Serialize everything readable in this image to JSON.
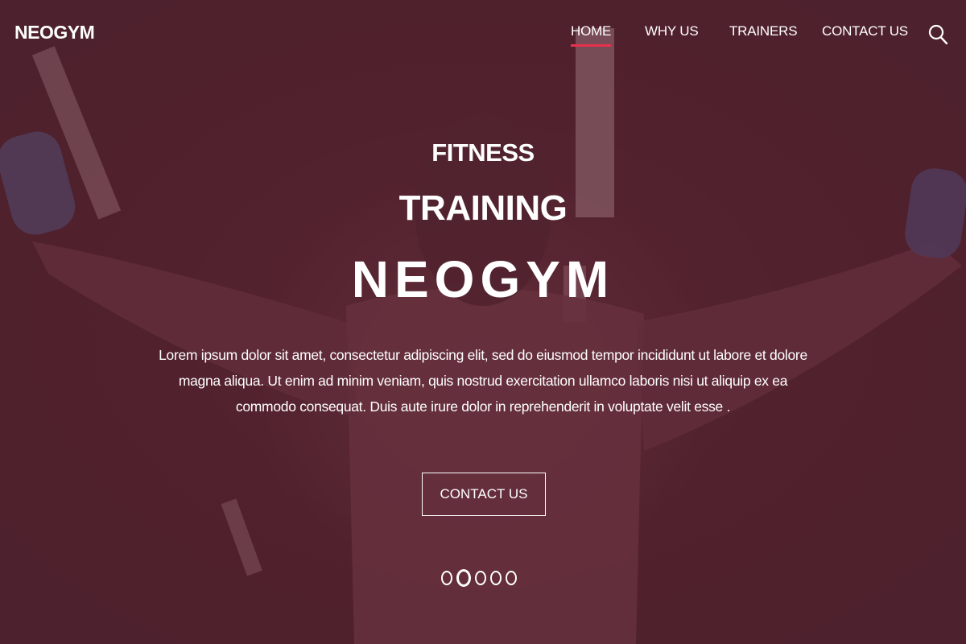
{
  "brand": {
    "logo_text": "NEOGYM"
  },
  "nav": {
    "items": [
      {
        "label": "HOME",
        "active": true
      },
      {
        "label": "WHY US",
        "active": false
      },
      {
        "label": "TRAINERS",
        "active": false
      },
      {
        "label": "CONTACT US",
        "active": false
      }
    ],
    "search_icon": "search-icon",
    "active_underline_color": "#e8314f"
  },
  "hero": {
    "line1": "FITNESS",
    "line2": "TRAINING",
    "line3": "NEOGYM",
    "description": "Lorem ipsum dolor sit amet, consectetur adipiscing elit, sed do eiusmod tempor incididunt ut labore et dolore magna aliqua. Ut enim ad minim veniam, quis nostrud exercitation ullamco laboris nisi ut aliquip ex ea commodo consequat. Duis aute irure dolor in reprehenderit in voluptate velit esse .",
    "cta_label": "CONTACT US",
    "overlay_color": "#5a2232"
  },
  "slider": {
    "slide_count": 5,
    "active_index": 1
  }
}
